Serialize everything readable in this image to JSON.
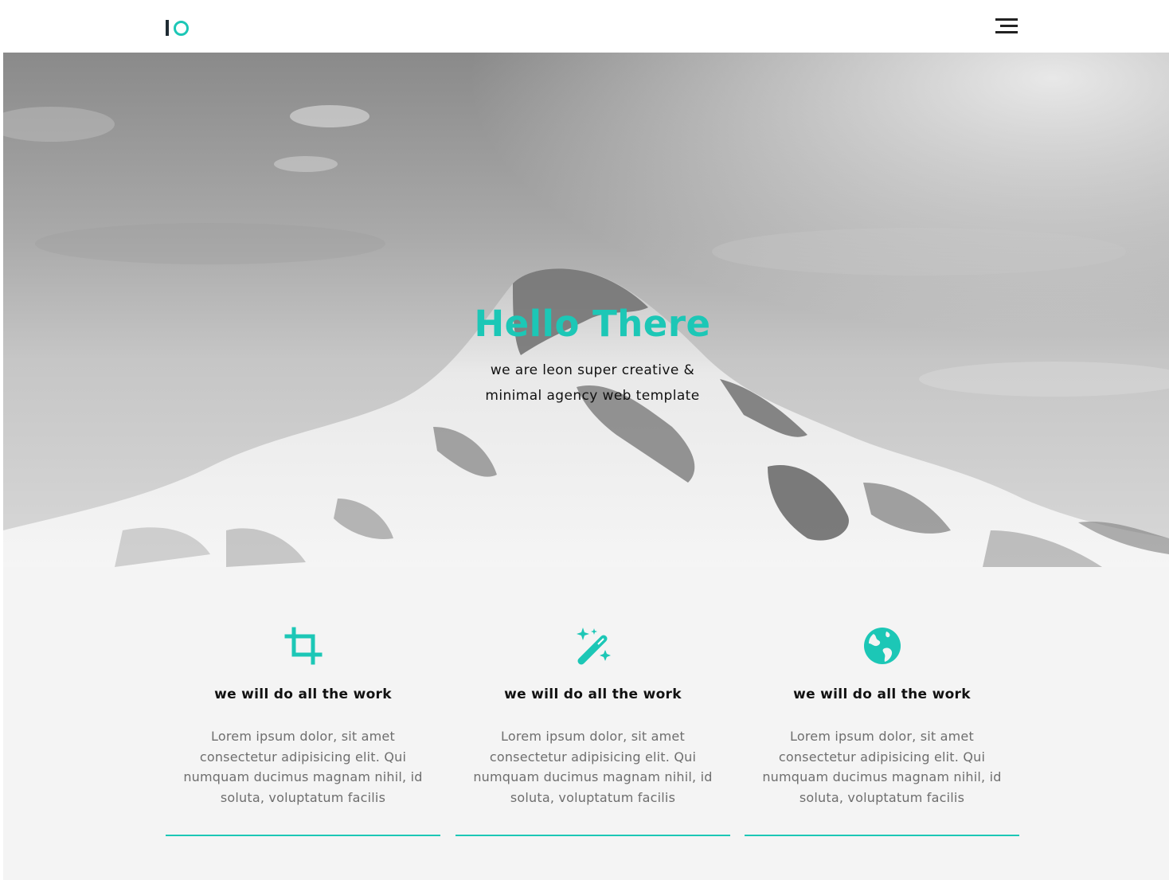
{
  "header": {
    "logo_alt": "IO",
    "menu_icon": "hamburger-menu-icon"
  },
  "hero": {
    "title": "Hello There",
    "subtitle_line1": "we are leon super creative &",
    "subtitle_line2": "minimal agency web template",
    "background": "grayscale snowy mountain peak"
  },
  "features": [
    {
      "icon": "crop-icon",
      "title": "we will do all the work",
      "text": "Lorem ipsum dolor, sit amet consectetur adipisicing elit. Qui numquam ducimus magnam nihil, id soluta, voluptatum facilis"
    },
    {
      "icon": "magic-wand-icon",
      "title": "we will do all the work",
      "text": "Lorem ipsum dolor, sit amet consectetur adipisicing elit. Qui numquam ducimus magnam nihil, id soluta, voluptatum facilis"
    },
    {
      "icon": "globe-icon",
      "title": "we will do all the work",
      "text": "Lorem ipsum dolor, sit amet consectetur adipisicing elit. Qui numquam ducimus magnam nihil, id soluta, voluptatum facilis"
    }
  ],
  "colors": {
    "accent": "#1cc7b6",
    "dark": "#1f2b33",
    "section_bg": "#f4f4f4",
    "body_text": "#6e6e6e"
  }
}
